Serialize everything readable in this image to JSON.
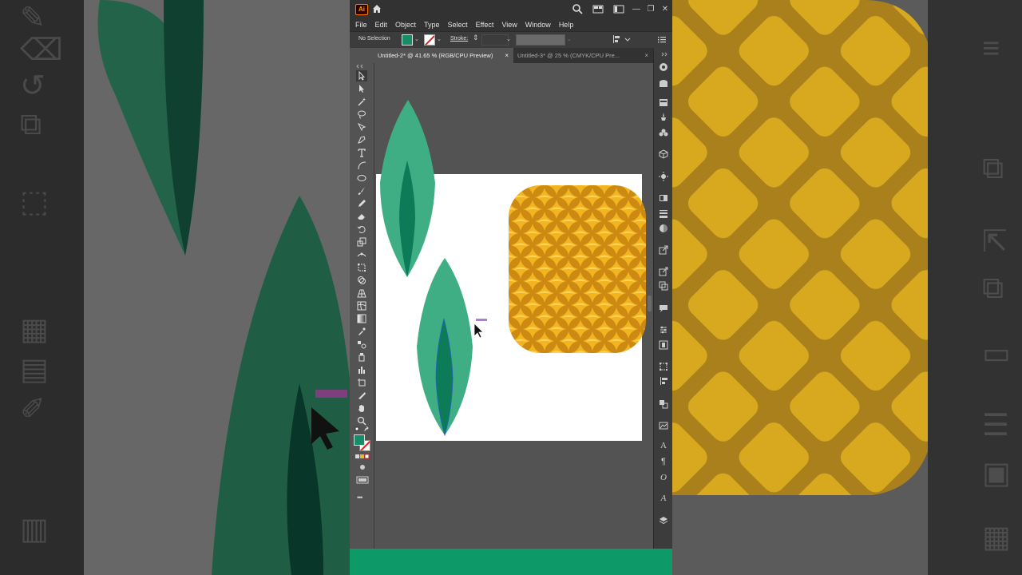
{
  "app": {
    "logo_text": "Ai",
    "menu": [
      "File",
      "Edit",
      "Object",
      "Type",
      "Select",
      "Effect",
      "View",
      "Window",
      "Help"
    ],
    "window_controls": [
      "—",
      "❐",
      "✕"
    ]
  },
  "control_bar": {
    "selection_label": "No Selection",
    "stroke_label": "Stroke:"
  },
  "tabs": [
    {
      "label": "Untitled-2* @ 41.65 % (RGB/CPU Preview)",
      "close": "×",
      "active": true
    },
    {
      "label": "Untitled-3* @ 25 % (CMYK/CPU Pre...",
      "close": "×",
      "active": false
    }
  ],
  "colors": {
    "fill": "#178c68",
    "leaf_light": "#3fae85",
    "leaf_dark": "#0b7b58",
    "pineapple_base": "#f2b51f",
    "pineapple_grid": "#cc8a12",
    "accent_bar": "#0e9a68"
  },
  "tools": [
    "selection-tool",
    "direct-selection-tool",
    "magic-wand-tool",
    "lasso-tool",
    "pen-tool",
    "curvature-tool",
    "type-tool",
    "arc-tool",
    "ellipse-tool",
    "paintbrush-tool",
    "pencil-tool",
    "eraser-tool",
    "rotate-tool",
    "scale-tool",
    "width-tool",
    "free-transform-tool",
    "shape-builder-tool",
    "perspective-grid-tool",
    "mesh-tool",
    "gradient-tool",
    "eyedropper-tool",
    "blend-tool",
    "symbol-sprayer-tool",
    "column-graph-tool",
    "artboard-tool",
    "slice-tool",
    "hand-tool",
    "zoom-tool"
  ],
  "more_tools": "•••"
}
